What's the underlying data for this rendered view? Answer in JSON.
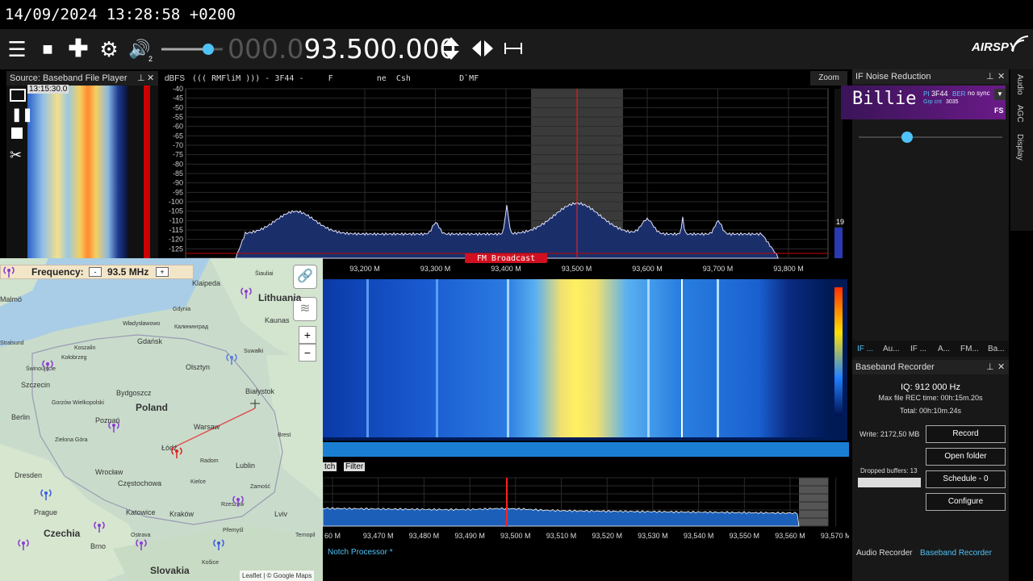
{
  "timestamp": "14/09/2024 13:28:58 +0200",
  "toolbar": {
    "frequency_dim": "000.0",
    "frequency_main": "93.500.000",
    "volume_sub": "2",
    "brand": "AIRSPY"
  },
  "source_panel": {
    "title": "Source: Baseband File Player",
    "time": "13:15:30.0",
    "pin": "ᵖ",
    "close": "✕"
  },
  "spectrum": {
    "unit_label": "dBFS",
    "rds_text": "((( RMFliM ))) - 3F44 -     F         ne  Csh          D`MF",
    "zoom_label": "Zoom",
    "y_ticks": [
      "-40",
      "-45",
      "-50",
      "-55",
      "-60",
      "-65",
      "-70",
      "-75",
      "-80",
      "-85",
      "-90",
      "-95",
      "-100",
      "-105",
      "-110",
      "-115",
      "-120",
      "-125"
    ],
    "x_ticks": [
      "93,200 M",
      "93,300 M",
      "93,400 M",
      "93,500 M",
      "93,600 M",
      "93,700 M",
      "93,800 M"
    ],
    "band_label": "FM Broadcast",
    "scale_right": "19"
  },
  "zoom_panel": {
    "tabs": [
      "tch",
      "Filter"
    ],
    "x_ticks": [
      "60 M",
      "93,470 M",
      "93,480 M",
      "93,490 M",
      "93,500 M",
      "93,510 M",
      "93,520 M",
      "93,530 M",
      "93,540 M",
      "93,550 M",
      "93,560 M",
      "93,570 M"
    ],
    "notch_label": "Notch Processor *"
  },
  "map": {
    "freq_label": "Frequency:",
    "freq_value": "93.5 MHz",
    "minus": "-",
    "plus": "+",
    "attribution": "Leaflet | © Google Maps",
    "zoom_in": "+",
    "zoom_out": "−",
    "places": [
      {
        "name": "Lithuania",
        "cls": "big"
      },
      {
        "name": "Klaipeda",
        "cls": "sm"
      },
      {
        "name": "Malmö",
        "cls": "sm"
      },
      {
        "name": "Kaunas",
        "cls": "sm"
      },
      {
        "name": "Gdańsk",
        "cls": "sm"
      },
      {
        "name": "Olsztyn",
        "cls": "sm"
      },
      {
        "name": "Szczecin",
        "cls": "sm"
      },
      {
        "name": "Bydgoszcz",
        "cls": "sm"
      },
      {
        "name": "Poland",
        "cls": "big"
      },
      {
        "name": "Białystok",
        "cls": "sm"
      },
      {
        "name": "Berlin",
        "cls": "sm"
      },
      {
        "name": "Poznań",
        "cls": "sm"
      },
      {
        "name": "Warsaw",
        "cls": "sm"
      },
      {
        "name": "Zielona Góra",
        "cls": "xs"
      },
      {
        "name": "Łódź",
        "cls": "sm"
      },
      {
        "name": "Brest",
        "cls": "xs"
      },
      {
        "name": "Wrocław",
        "cls": "sm"
      },
      {
        "name": "Radom",
        "cls": "xs"
      },
      {
        "name": "Lublin",
        "cls": "sm"
      },
      {
        "name": "Dresden",
        "cls": "sm"
      },
      {
        "name": "Częstochowa",
        "cls": "sm"
      },
      {
        "name": "Kielce",
        "cls": "xs"
      },
      {
        "name": "Zamość",
        "cls": "xs"
      },
      {
        "name": "Prague",
        "cls": "sm"
      },
      {
        "name": "Katowice",
        "cls": "sm"
      },
      {
        "name": "Kraków",
        "cls": "sm"
      },
      {
        "name": "Czechia",
        "cls": "big"
      },
      {
        "name": "Lviv",
        "cls": "sm"
      },
      {
        "name": "Brno",
        "cls": "sm"
      },
      {
        "name": "Ostrava",
        "cls": "xs"
      },
      {
        "name": "Rzeszów",
        "cls": "xs"
      },
      {
        "name": "Přemyśl",
        "cls": "xs"
      },
      {
        "name": "Slovakia",
        "cls": "big"
      },
      {
        "name": "Košice",
        "cls": "xs"
      },
      {
        "name": "Ternopil",
        "cls": "xs"
      },
      {
        "name": "Suwałki",
        "cls": "xs"
      },
      {
        "name": "Koszalin",
        "cls": "xs"
      },
      {
        "name": "Kołobrzeg",
        "cls": "xs"
      },
      {
        "name": "Gorzów Wielkopolski",
        "cls": "xs"
      },
      {
        "name": "Stralsund",
        "cls": "xs"
      },
      {
        "name": "Świnoujście",
        "cls": "xs"
      },
      {
        "name": "Калининград",
        "cls": "xs"
      },
      {
        "name": "Władysławowo",
        "cls": "xs"
      },
      {
        "name": "Šiauliai",
        "cls": "xs"
      },
      {
        "name": "Gdynia",
        "cls": "xs"
      }
    ]
  },
  "if_panel": {
    "title": "IF Noise Reduction",
    "rds_name": "Billie",
    "pi_label": "PI",
    "pi_value": "3F44",
    "ber_label": "BER",
    "sync": "no sync",
    "grp_label": "Grp cnt",
    "grp_value": "3035",
    "fs": "FS",
    "side_tabs": [
      "Audio",
      "AGC",
      "Display"
    ],
    "tabs": [
      "IF ...",
      "Au...",
      "IF ...",
      "A...",
      "FM...",
      "Ba..."
    ]
  },
  "recorder": {
    "title": "Baseband Recorder",
    "iq": "IQ: 912 000 Hz",
    "max_time": "Max file REC time: 00h:15m.20s",
    "total": "Total: 00h:10m.24s",
    "write": "Write:  2172,50 MB",
    "dropped": "Dropped buffers: 13",
    "buttons": [
      "Record",
      "Open folder",
      "Schedule - 0",
      "Configure"
    ],
    "bottom_tabs": [
      "Audio Recorder",
      "Baseband Recorder"
    ]
  },
  "colors": {
    "accent": "#4fc3f7",
    "peak": "#ff2222",
    "panel": "#181818",
    "spectrum_fill": "#1a2f6a"
  }
}
